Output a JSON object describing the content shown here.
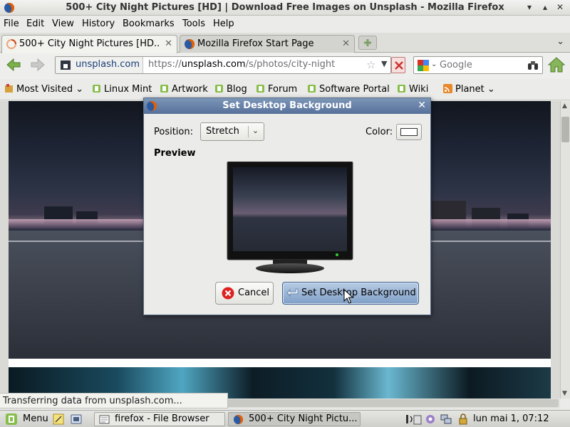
{
  "window": {
    "title": "500+ City Night Pictures [HD] | Download Free Images on Unsplash - Mozilla Firefox"
  },
  "menubar": {
    "items": [
      "File",
      "Edit",
      "View",
      "History",
      "Bookmarks",
      "Tools",
      "Help"
    ]
  },
  "tabs": [
    {
      "label": "500+ City Night Pictures [HD...",
      "icon": "loading-icon",
      "active": true
    },
    {
      "label": "Mozilla Firefox Start Page",
      "icon": "firefox-icon",
      "active": false
    }
  ],
  "navbar": {
    "identity_domain": "unsplash.com",
    "url_prefix": "https://",
    "url_host": "unsplash.com",
    "url_path": "/s/photos/city-night",
    "search_placeholder": "Google"
  },
  "bookmarks": [
    {
      "label": "Most Visited",
      "icon": "bookmark-folder-icon",
      "dropdown": true
    },
    {
      "label": "Linux Mint",
      "icon": "mint-icon",
      "dropdown": false
    },
    {
      "label": "Artwork",
      "icon": "mint-icon",
      "dropdown": false
    },
    {
      "label": "Blog",
      "icon": "mint-icon",
      "dropdown": false
    },
    {
      "label": "Forum",
      "icon": "mint-icon",
      "dropdown": false
    },
    {
      "label": "Software Portal",
      "icon": "mint-icon",
      "dropdown": false
    },
    {
      "label": "Wiki",
      "icon": "mint-icon",
      "dropdown": false
    },
    {
      "label": "Planet",
      "icon": "rss-icon",
      "dropdown": true
    }
  ],
  "status": {
    "text": "Transferring data from unsplash.com..."
  },
  "dialog": {
    "title": "Set Desktop Background",
    "position_label": "Position:",
    "position_value": "Stretch",
    "color_label": "Color:",
    "color_value": "#ffffff",
    "preview_label": "Preview",
    "cancel_label": "Cancel",
    "set_label": "Set Desktop Background"
  },
  "taskbar": {
    "menu_label": "Menu",
    "tasks": [
      {
        "label": "firefox - File Browser",
        "icon": "folder-icon",
        "active": false
      },
      {
        "label": "500+ City Night Pictu...",
        "icon": "firefox-icon",
        "active": true
      }
    ],
    "clock": "lun mai  1, 07:12"
  },
  "colors": {
    "dialog_title_bg": "#5f7aa3",
    "primary_button": "#8fabd0",
    "stop_button": "#cc3333",
    "link_blue": "#1a3f7a"
  }
}
